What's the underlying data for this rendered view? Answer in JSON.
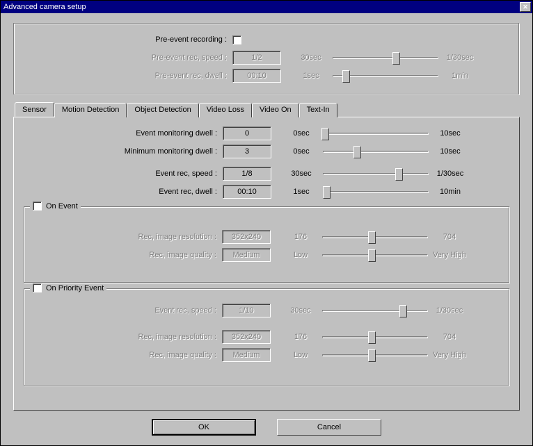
{
  "window": {
    "title": "Advanced camera setup"
  },
  "preevent": {
    "label": "Pre-event recording :",
    "speed_label": "Pre-event rec, speed :",
    "speed_value": "1/2",
    "speed_min": "30sec",
    "speed_max": "1/30sec",
    "dwell_label": "Pre-event rec, dwell :",
    "dwell_value": "00:10",
    "dwell_min": "1sec",
    "dwell_max": "1min"
  },
  "tabs": {
    "t0": "Sensor",
    "t1": "Motion Detection",
    "t2": "Object Detection",
    "t3": "Video Loss",
    "t4": "Video On",
    "t5": "Text-In"
  },
  "sensor": {
    "evmon_label": "Event monitoring dwell :",
    "evmon_value": "0",
    "evmon_min": "0sec",
    "evmon_max": "10sec",
    "minmon_label": "Minimum monitoring dwell :",
    "minmon_value": "3",
    "minmon_min": "0sec",
    "minmon_max": "10sec",
    "evspeed_label": "Event rec, speed :",
    "evspeed_value": "1/8",
    "evspeed_min": "30sec",
    "evspeed_max": "1/30sec",
    "evdwell_label": "Event rec, dwell :",
    "evdwell_value": "00:10",
    "evdwell_min": "1sec",
    "evdwell_max": "10min"
  },
  "onevent": {
    "legend": "On Event",
    "res_label": "Rec, image resolution :",
    "res_value": "352x240",
    "res_min": "176",
    "res_max": "704",
    "q_label": "Rec, image quality :",
    "q_value": "Medium",
    "q_min": "Low",
    "q_max": "Very High"
  },
  "onpriority": {
    "legend": "On Priority Event",
    "speed_label": "Event rec, speed :",
    "speed_value": "1/10",
    "speed_min": "30sec",
    "speed_max": "1/30sec",
    "res_label": "Rec, image resolution :",
    "res_value": "352x240",
    "res_min": "176",
    "res_max": "704",
    "q_label": "Rec, image quality :",
    "q_value": "Medium",
    "q_min": "Low",
    "q_max": "Very High"
  },
  "buttons": {
    "ok": "OK",
    "cancel": "Cancel"
  }
}
